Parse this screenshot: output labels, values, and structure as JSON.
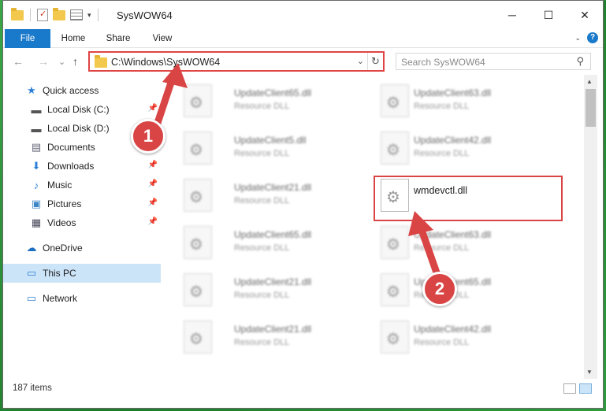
{
  "window": {
    "title": "SysWOW64",
    "minimize": "─",
    "maximize": "☐",
    "close": "✕"
  },
  "ribbon": {
    "tabs": [
      {
        "label": "File"
      },
      {
        "label": "Home"
      },
      {
        "label": "Share"
      },
      {
        "label": "View"
      }
    ],
    "help": "?"
  },
  "nav": {
    "back": "←",
    "forward": "→",
    "recent": "⌄",
    "up": "↑",
    "address": "C:\\Windows\\SysWOW64",
    "search_placeholder": "Search SysWOW64"
  },
  "sidebar": {
    "items": [
      {
        "label": "Quick access",
        "icon": "star-icon"
      },
      {
        "label": "Local Disk (C:)",
        "icon": "drive-icon"
      },
      {
        "label": "Local Disk (D:)",
        "icon": "drive-icon"
      },
      {
        "label": "Documents",
        "icon": "documents-icon"
      },
      {
        "label": "Downloads",
        "icon": "download-icon"
      },
      {
        "label": "Music",
        "icon": "music-icon"
      },
      {
        "label": "Pictures",
        "icon": "pictures-icon"
      },
      {
        "label": "Videos",
        "icon": "videos-icon"
      },
      {
        "label": "OneDrive",
        "icon": "cloud-icon"
      },
      {
        "label": "This PC",
        "icon": "computer-icon"
      },
      {
        "label": "Network",
        "icon": "network-icon"
      }
    ]
  },
  "files": {
    "left": [
      {
        "name": "UpdateClient65.dll",
        "type": "Resource DLL"
      },
      {
        "name": "UpdateClient5.dll",
        "type": "Resource DLL"
      },
      {
        "name": "UpdateClient21.dll",
        "type": "Resource DLL"
      },
      {
        "name": "UpdateClient65.dll",
        "type": "Resource DLL"
      },
      {
        "name": "UpdateClient21.dll",
        "type": "Resource DLL"
      },
      {
        "name": "UpdateClient21.dll",
        "type": "Resource DLL"
      }
    ],
    "right": [
      {
        "name": "UpdateClient63.dll",
        "type": "Resource DLL"
      },
      {
        "name": "UpdateClient42.dll",
        "type": "Resource DLL"
      },
      {
        "name": "wmdevctl.dll",
        "type": ""
      },
      {
        "name": "UpdateClient63.dll",
        "type": "Resource DLL"
      },
      {
        "name": "UpdateClient65.dll",
        "type": "Resource DLL"
      },
      {
        "name": "UpdateClient42.dll",
        "type": "Resource DLL"
      }
    ]
  },
  "status": {
    "count": "187 items"
  },
  "annotations": {
    "step1": "1",
    "step2": "2",
    "color": "#d94444"
  }
}
